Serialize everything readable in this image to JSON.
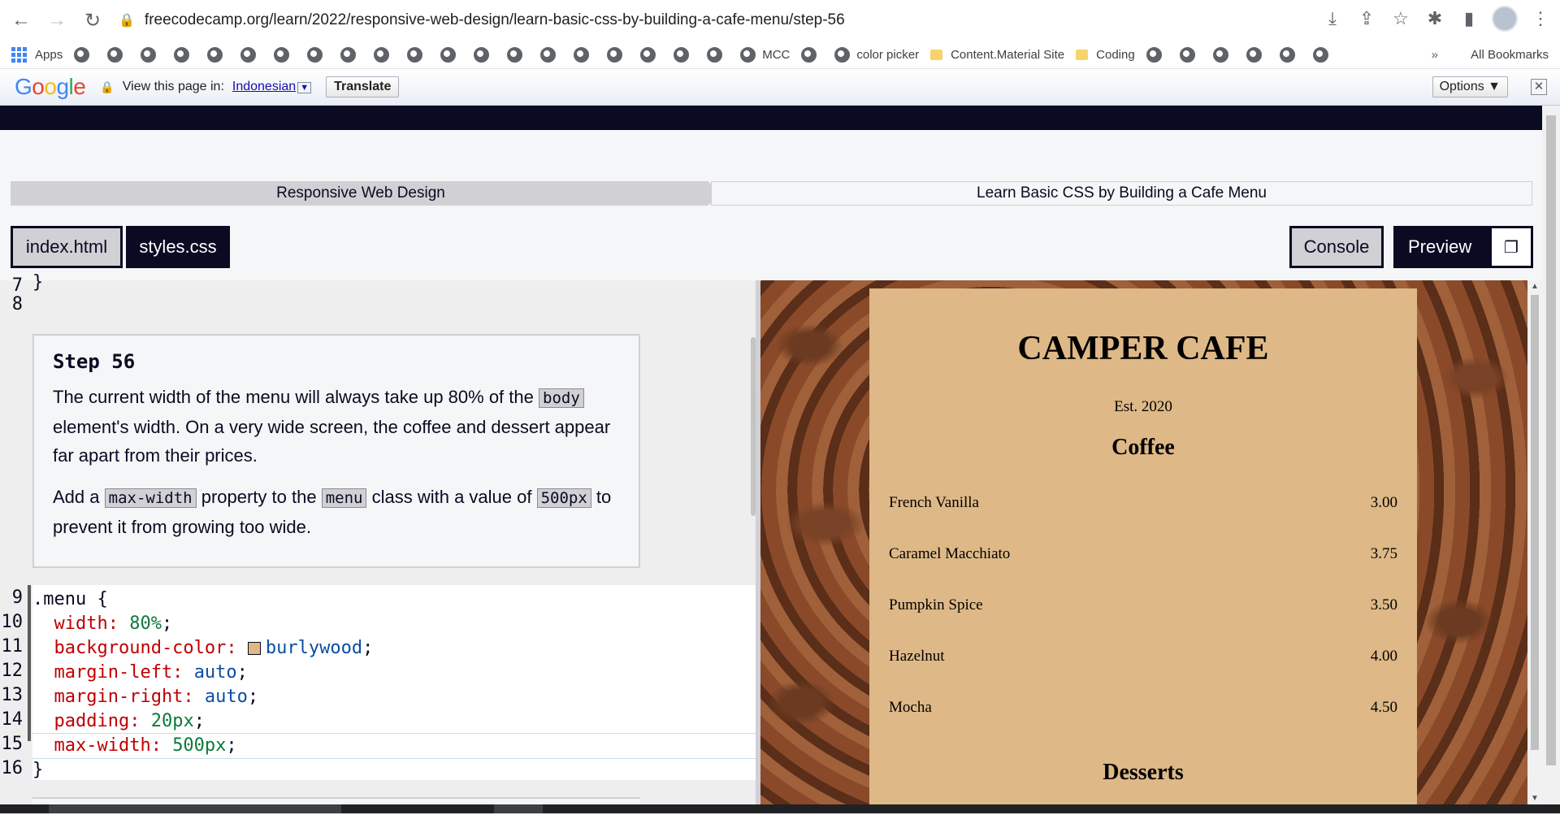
{
  "browser": {
    "url": "freecodecamp.org/learn/2022/responsive-web-design/learn-basic-css-by-building-a-cafe-menu/step-56"
  },
  "bookmarks": {
    "apps_label": "Apps",
    "mcc": "MCC",
    "color_picker": "color picker",
    "content_material": "Content.Material Site",
    "coding": "Coding",
    "more": "»",
    "all_bookmarks": "All Bookmarks"
  },
  "translate_bar": {
    "logo": "Google",
    "view_text": "View this page in:",
    "language": "Indonesian",
    "translate_button": "Translate",
    "options_button": "Options ▼",
    "close": "✕"
  },
  "breadcrumb": {
    "superblock": "Responsive Web Design",
    "block": "Learn Basic CSS by Building a Cafe Menu"
  },
  "tabs": {
    "index": "index.html",
    "styles": "styles.css",
    "console": "Console",
    "preview": "Preview"
  },
  "editor": {
    "lines_top": [
      "7",
      "8"
    ],
    "top_code": "}",
    "step_title": "Step 56",
    "para1_a": "The current width of the menu will always take up 80% of the",
    "para1_code": "body",
    "para1_b": "element's width. On a very wide screen, the coffee and dessert appear far apart from their prices.",
    "para2_a": "Add a",
    "para2_code1": "max-width",
    "para2_b": "property to the",
    "para2_code2": "menu",
    "para2_c": "class with a value of",
    "para2_code3": "500px",
    "para2_d": "to prevent it from growing too wide.",
    "code_line_numbers": [
      "9",
      "10",
      "11",
      "12",
      "13",
      "14",
      "15",
      "16"
    ],
    "code": {
      "l9_sel": ".menu ",
      "l9_brace": "{",
      "l10_prop": "  width: ",
      "l10_val": "80%",
      "l11_prop": "  background-color: ",
      "l11_val": "burlywood",
      "l12_prop": "  margin-left: ",
      "l12_val": "auto",
      "l13_prop": "  margin-right: ",
      "l13_val": "auto",
      "l14_prop": "  padding: ",
      "l14_val": "20px",
      "l15_prop": "  max-width: ",
      "l15_val": "500px",
      "semicolon": ";",
      "l16_brace": "}"
    }
  },
  "preview": {
    "cafe_name": "CAMPER CAFE",
    "established": "Est. 2020",
    "coffee_heading": "Coffee",
    "coffee_items": [
      {
        "flavor": "French Vanilla",
        "price": "3.00"
      },
      {
        "flavor": "Caramel Macchiato",
        "price": "3.75"
      },
      {
        "flavor": "Pumpkin Spice",
        "price": "3.50"
      },
      {
        "flavor": "Hazelnut",
        "price": "4.00"
      },
      {
        "flavor": "Mocha",
        "price": "4.50"
      }
    ],
    "desserts_heading": "Desserts"
  },
  "colors": {
    "fcc_dark": "#0a0a23",
    "burlywood": "#deb887",
    "secondary": "#d0d0d5"
  }
}
